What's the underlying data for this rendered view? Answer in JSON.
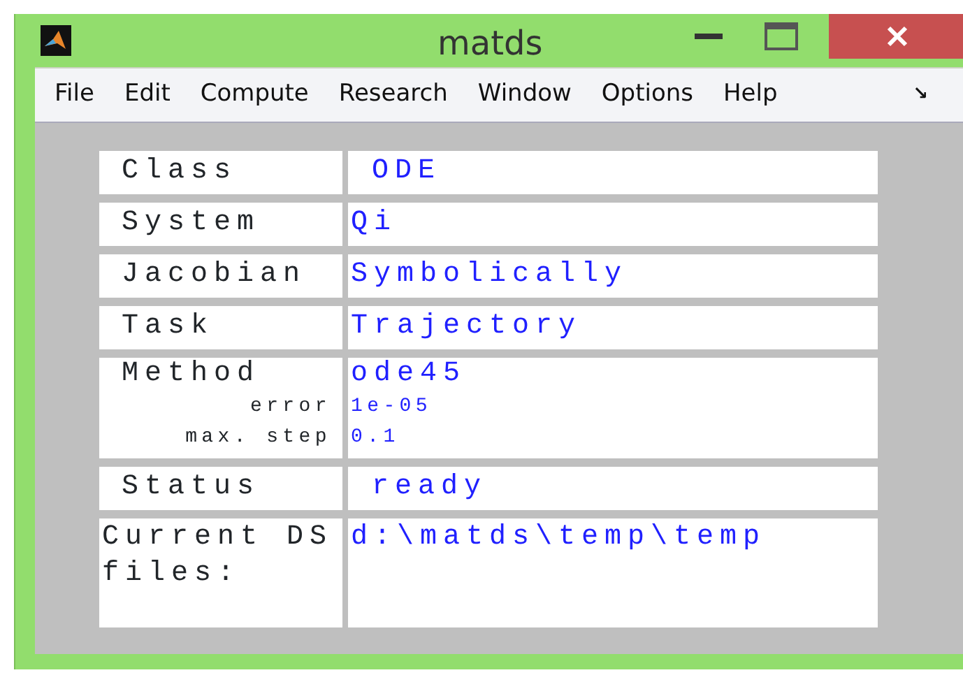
{
  "window": {
    "title": "matds"
  },
  "menu": [
    "File",
    "Edit",
    "Compute",
    "Research",
    "Window",
    "Options",
    "Help"
  ],
  "menu_overflow": "↘",
  "rows": [
    {
      "label": "Class",
      "value": "ODE",
      "label_indented": true,
      "value_indented": true
    },
    {
      "label": "System",
      "value": "Qi",
      "label_indented": true,
      "value_indented": false
    },
    {
      "label": "Jacobian",
      "value": "Symbolically",
      "label_indented": true,
      "value_indented": false
    },
    {
      "label": "Task",
      "value": "Trajectory",
      "label_indented": true,
      "value_indented": false
    },
    {
      "label": "Method",
      "value": "ode45",
      "label_indented": true,
      "value_indented": false,
      "params": [
        {
          "label": "error",
          "value": "1e-05"
        },
        {
          "label": "max. step",
          "value": "0.1"
        }
      ]
    },
    {
      "label": "Status",
      "value": "ready",
      "label_indented": true,
      "value_indented": true
    },
    {
      "label": "Current DS files:",
      "value": "d:\\matds\\temp\\temp",
      "label_indented": false,
      "value_indented": false,
      "tall": true
    }
  ]
}
